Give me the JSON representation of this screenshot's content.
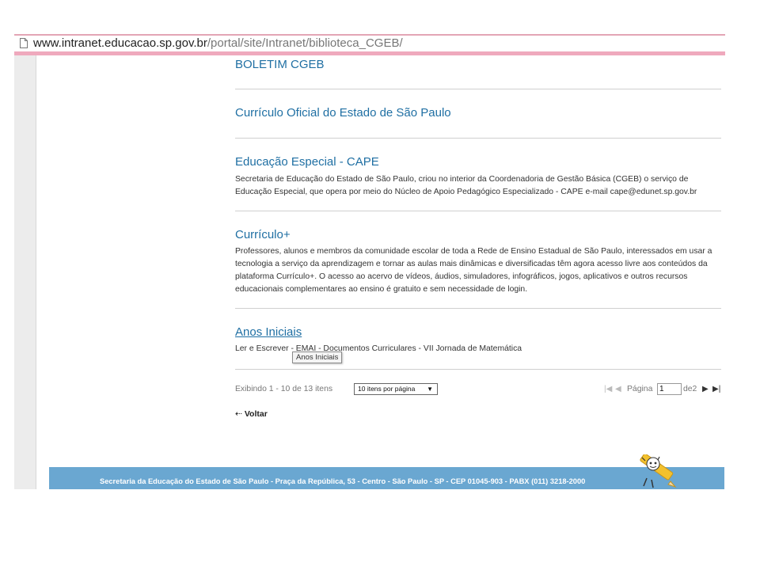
{
  "browser": {
    "url_host": "www.intranet.educacao.sp.gov.br",
    "url_path": "/portal/site/Intranet/biblioteca_CGEB/"
  },
  "sections": [
    {
      "title": "BOLETIM CGEB"
    },
    {
      "title": "Currículo Oficial do Estado de São Paulo"
    },
    {
      "title": "Educação Especial - CAPE",
      "description": "Secretaria de Educação do Estado de São Paulo, criou no interior da Coordenadoria de Gestão Básica (CGEB) o serviço de Educação Especial, que opera por meio do Núcleo de Apoio Pedagógico Especializado - CAPE e-mail cape@edunet.sp.gov.br"
    },
    {
      "title": "Currículo+",
      "description": "Professores, alunos e membros da comunidade escolar de toda a Rede de Ensino Estadual de São Paulo, interessados em usar a tecnologia a serviço da aprendizagem e tornar as aulas mais dinâmicas e diversificadas têm agora acesso livre aos conteúdos da plataforma Currículo+. O acesso ao acervo de vídeos, áudios, simuladores, infográficos, jogos, aplicativos e outros recursos educacionais complementares ao ensino é gratuito e sem necessidade de login."
    },
    {
      "title": "Anos Iniciais",
      "description": "Ler e Escrever - EMAI - Documentos Curriculares - VII Jornada de Matemática",
      "tooltip": "Anos Iniciais"
    }
  ],
  "pager": {
    "info": "Exibindo 1 - 10 de 13 itens",
    "per_page": "10 itens por página",
    "page_label": "Página",
    "current_page": "1",
    "total_label": "de2"
  },
  "voltar": "Voltar",
  "footer": {
    "text": "Secretaria da Educação do Estado de São Paulo - Praça da República, 53 - Centro - São Paulo - SP - CEP 01045-903 - PABX (011) 3218-2000"
  },
  "colors": {
    "link": "#1f6fa3",
    "footer_bg": "#6aa7d1",
    "browser_accent": "#efa9bd"
  }
}
